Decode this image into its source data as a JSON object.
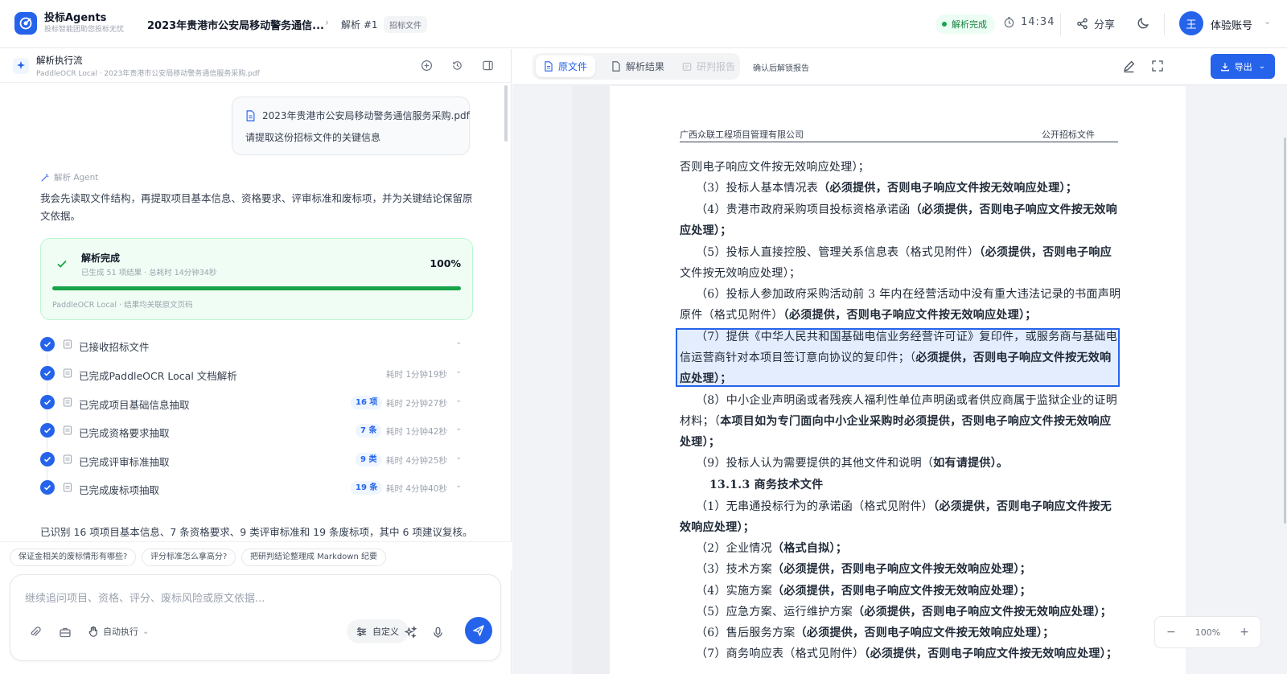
{
  "header": {
    "app_name": "投标Agents",
    "app_tagline": "投标智能团助您投标无忧",
    "doc_title": "2023年贵港市公安局移动警务通信...",
    "crumb": "解析 #1",
    "file_tag": "招标文件",
    "status": "解析完成",
    "timer": "14:34",
    "share": "分享",
    "avatar_initial": "王",
    "account": "体验账号"
  },
  "left": {
    "title": "解析执行流",
    "subtitle": "PaddleOCR Local · 2023年贵港市公安局移动警务通信服务采购.pdf",
    "user_file": "2023年贵港市公安局移动警务通信服务采购.pdf",
    "user_msg": "请提取这份招标文件的关键信息",
    "agent_label": "解析 Agent",
    "agent_msg": "我会先读取文件结构，再提取项目基本信息、资格要求、评审标准和废标项，并为关键结论保留原文依据。",
    "card": {
      "title": "解析完成",
      "sub": "已生成 51 项结果 · 总耗时 14分钟34秒",
      "percent": "100%",
      "progress": 1.0,
      "foot": "PaddleOCR Local · 结果均关联原文页码"
    },
    "steps": [
      {
        "label": "已接收招标文件",
        "badge": "",
        "duration": ""
      },
      {
        "label": "已完成PaddleOCR Local 文档解析",
        "badge": "",
        "duration": "耗时 1分钟19秒"
      },
      {
        "label": "已完成项目基础信息抽取",
        "badge": "16 项",
        "duration": "耗时 2分钟27秒"
      },
      {
        "label": "已完成资格要求抽取",
        "badge": "7 条",
        "duration": "耗时 1分钟42秒"
      },
      {
        "label": "已完成评审标准抽取",
        "badge": "9 类",
        "duration": "耗时 4分钟25秒"
      },
      {
        "label": "已完成废标项抽取",
        "badge": "19 条",
        "duration": "耗时 4分钟40秒"
      }
    ],
    "summary": "已识别 16 项项目基本信息、7 条资格要求、9 类评审标准和 19 条废标项，其中 6 项建议复核。",
    "chips": [
      "保证金相关的废标情形有哪些?",
      "评分标准怎么拿高分?",
      "把研判结论整理成 Markdown 纪要"
    ],
    "composer": {
      "placeholder": "继续追问项目、资格、评分、废标风险或原文依据...",
      "auto": "自动执行",
      "custom": "自定义"
    }
  },
  "right": {
    "tabs": [
      "原文件",
      "解析结果",
      "研判报告"
    ],
    "unlock": "确认后解锁报告",
    "export": "导出",
    "zoom": "100%",
    "page_header_left": "广西众联工程项目管理有限公司",
    "page_header_right": "公开招标文件",
    "lines": [
      {
        "n": "否则电子响应文件按无效响应处理）；",
        "b": ""
      },
      {
        "n": "（3）投标人基本情况表",
        "b": "（必须提供，否则电子响应文件按无效响应处理）；"
      },
      {
        "n": "（4）贵港市政府采购项目投标资格承诺函",
        "b": "（必须提供，否则电子响应文件按无效响"
      },
      {
        "n": "",
        "b": "应处理）；"
      },
      {
        "n": "（5）投标人直接控股、管理关系信息表（格式见附件）",
        "b": "（必须提供，否则电子响应"
      },
      {
        "n": "文件按无效响应处理）；",
        "b": ""
      },
      {
        "n": "（6）投标人参加政府采购活动前 3 年内在经营活动中没有重大违法记录的书面声明",
        "b": ""
      },
      {
        "n": "原件（格式见附件）",
        "b": "（必须提供，否则电子响应文件按无效响应处理）；"
      },
      {
        "n": "（7）提供《中华人民共和国基础电信业务经营许可证》复印件，或服务商与基础电",
        "b": ""
      },
      {
        "n": "信运营商针对本项目签订意向协议的复印件；（",
        "b": "必须提供，否则电子响应文件按无效响"
      },
      {
        "n": "",
        "b": "应处理）；"
      },
      {
        "n": "（8）中小企业声明函或者残疾人福利性单位声明函或者供应商属于监狱企业的证明",
        "b": ""
      },
      {
        "n": "材料；（",
        "b": "本项目如为专门面向中小企业采购时必须提供，否则电子响应文件按无效响应"
      },
      {
        "n": "",
        "b": "处理）；"
      },
      {
        "n": "（9）投标人认为需要提供的其他文件和说明（",
        "b": "如有请提供）。"
      },
      {
        "n": "",
        "b": "13.1.3  商务技术文件"
      },
      {
        "n": "（1）无串通投标行为的承诺函（格式见附件）",
        "b": "（必须提供，否则电子响应文件按无"
      },
      {
        "n": "",
        "b": "效响应处理）；"
      },
      {
        "n": "（2）企业情况",
        "b": "（格式自拟）；"
      },
      {
        "n": "（3）技术方案",
        "b": "（必须提供，否则电子响应文件按无效响应处理）；"
      },
      {
        "n": "（4）实施方案",
        "b": "（必须提供，否则电子响应文件按无效响应处理）；"
      },
      {
        "n": "（5）应急方案、运行维护方案",
        "b": "（必须提供，否则电子响应文件按无效响应处理）；"
      },
      {
        "n": "（6）售后服务方案",
        "b": "（必须提供，否则电子响应文件按无效响应处理）；"
      },
      {
        "n": "（7）商务响应表（格式见附件）",
        "b": "（必须提供，否则电子响应文件按无效响应处理）；"
      }
    ]
  },
  "colors": {
    "accent": "#2563eb",
    "success": "#16a34a",
    "highlight": "#3b82f6"
  },
  "icons": [
    "logo-icon",
    "clock-icon",
    "share-icon",
    "moon-icon",
    "chevron-down-icon",
    "plus-circle-icon",
    "history-icon",
    "panel-icon",
    "file-icon",
    "sparkle-icon",
    "check-icon",
    "attach-icon",
    "toolbox-icon",
    "hand-icon",
    "sliders-icon",
    "magic-icon",
    "mic-icon",
    "send-icon",
    "edit-icon",
    "fullscreen-icon",
    "download-icon"
  ]
}
